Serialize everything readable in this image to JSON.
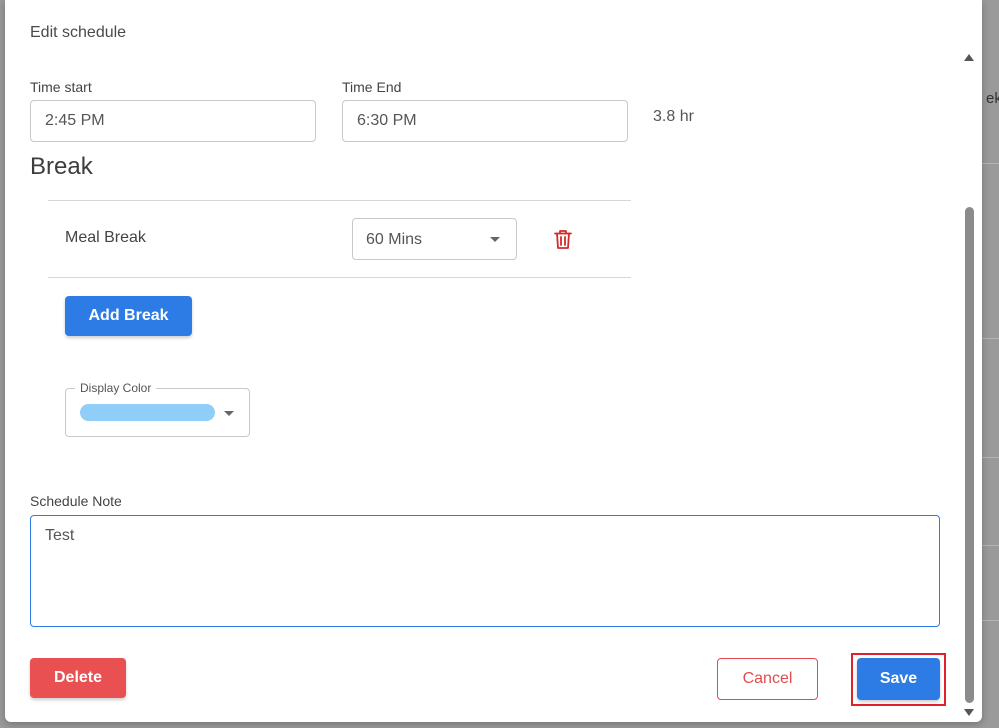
{
  "dialog": {
    "title": "Edit schedule"
  },
  "time": {
    "start_label": "Time start",
    "start_value": "2:45 PM",
    "end_label": "Time End",
    "end_value": "6:30 PM",
    "duration": "3.8 hr"
  },
  "breaks": {
    "heading": "Break",
    "items": [
      {
        "name": "Meal Break",
        "duration": "60 Mins"
      }
    ],
    "add_label": "Add Break"
  },
  "display_color": {
    "label": "Display Color",
    "value_color": "#90cdf9"
  },
  "note": {
    "label": "Schedule Note",
    "value": "Test"
  },
  "actions": {
    "delete_label": "Delete",
    "cancel_label": "Cancel",
    "save_label": "Save"
  },
  "background": {
    "peek_text": "ek"
  },
  "colors": {
    "primary": "#2d7be5",
    "danger": "#e95052",
    "highlight": "#e0202a",
    "trash_icon": "#d62a2a"
  }
}
